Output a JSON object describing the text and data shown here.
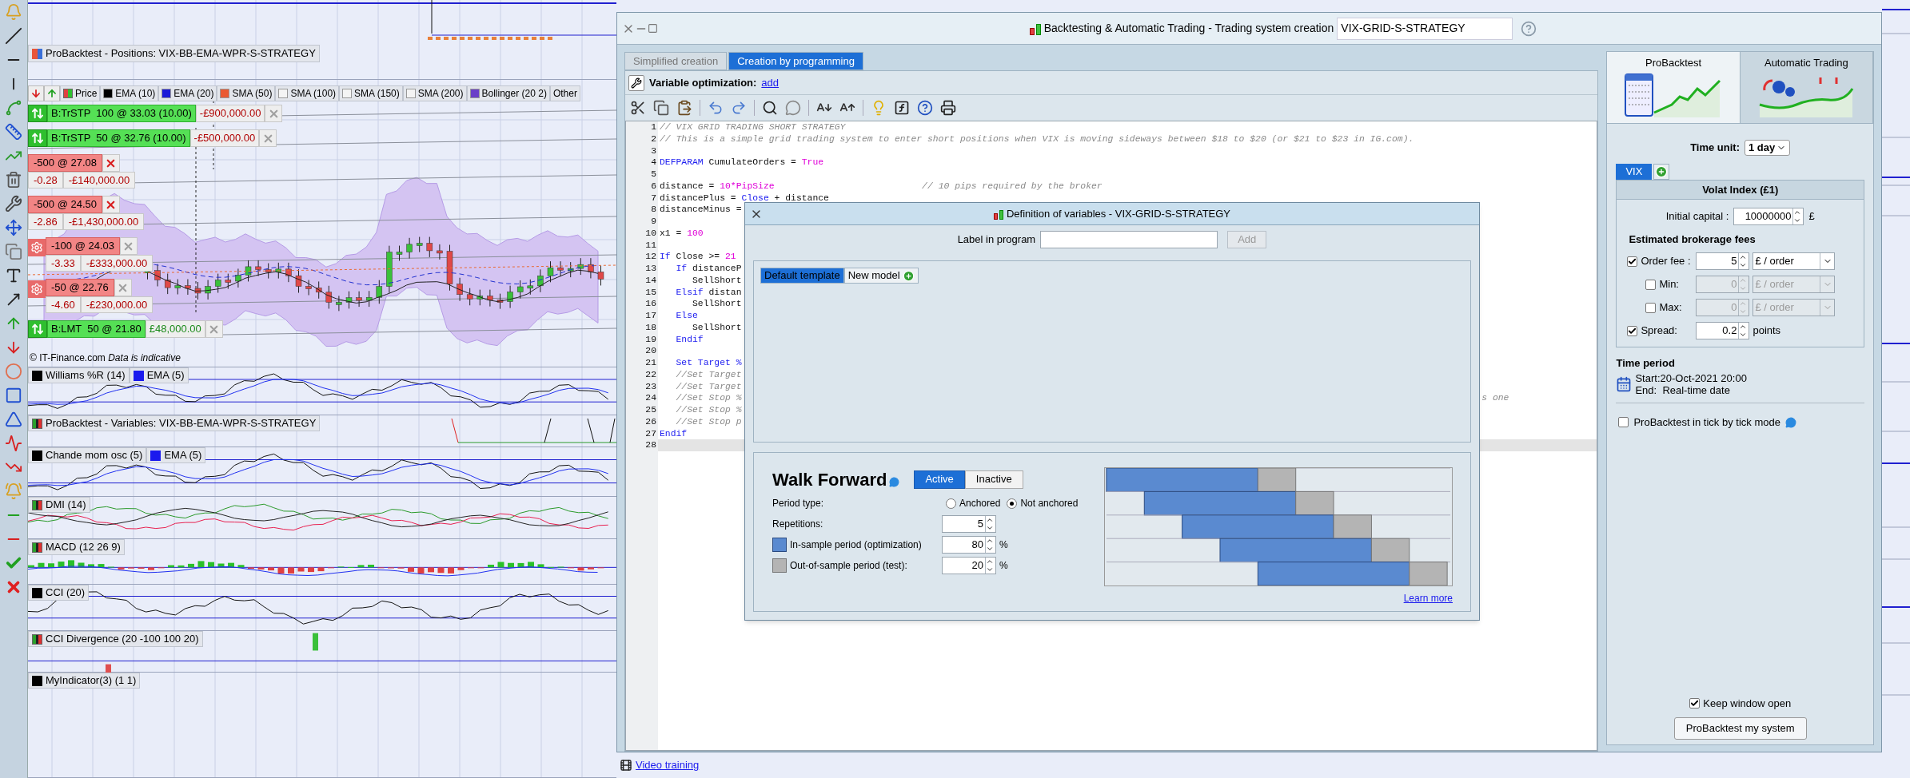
{
  "chart": {
    "positions_label": {
      "text": "ProBacktest - Positions: VIX-BB-EMA-WPR-S-STRATEGY"
    },
    "legend": [
      {
        "text": "Price",
        "kind": "price"
      },
      {
        "text": "EMA (10)",
        "kind": "line",
        "color": "#000000"
      },
      {
        "text": "EMA (20)",
        "kind": "line",
        "color": "#1a1ad8"
      },
      {
        "text": "SMA (50)",
        "kind": "line",
        "color": "#ea5a32"
      },
      {
        "text": "SMA (100)",
        "kind": "line",
        "color": "#f4f4f4"
      },
      {
        "text": "SMA (150)",
        "kind": "line",
        "color": "#f4f4f4"
      },
      {
        "text": "SMA (200)",
        "kind": "line",
        "color": "#f4f4f4"
      },
      {
        "text": "Bollinger (20 2)",
        "kind": "line",
        "color": "#6a3fc8"
      },
      {
        "text": "Other",
        "kind": "text"
      }
    ],
    "orders": [
      {
        "kind": "buy",
        "text": "B:TrSTP  100 @ 33.03 (10.00)",
        "value": "-£900,000.00",
        "profit": false
      },
      {
        "kind": "buy",
        "text": "B:TrSTP  50 @ 32.76 (10.00)",
        "value": "-£500,000.00",
        "profit": false
      },
      {
        "kind": "position",
        "text": "-500 @ 27.08",
        "points": "-0.28",
        "value": "-£140,000.00",
        "profit": false
      },
      {
        "kind": "position",
        "text": "-500 @ 24.50",
        "points": "-2.86",
        "value": "-£1,430,000.00",
        "profit": false
      },
      {
        "kind": "pending",
        "text": "-100 @ 24.03",
        "points": "-3.33",
        "value": "-£333,000.00",
        "profit": false
      },
      {
        "kind": "pending",
        "text": "-50 @ 22.76",
        "points": "-4.60",
        "value": "-£230,000.00",
        "profit": false
      },
      {
        "kind": "buy",
        "text": "B:LMT  50 @ 21.80",
        "value": "£48,000.00",
        "profit": true
      }
    ],
    "copyright": "© IT-Finance.com  *Data is indicative*",
    "panes": [
      {
        "kind": "oscillator",
        "legend": [
          {
            "text": "Williams %R (14)",
            "color": "#000000"
          },
          {
            "text": "EMA (5)",
            "color": "#1a1aee"
          }
        ]
      },
      {
        "kind": "signal",
        "legend": [
          {
            "text": "ProBacktest - Variables: VIX-BB-EMA-WPR-S-STRATEGY"
          }
        ]
      },
      {
        "kind": "oscillator",
        "legend": [
          {
            "text": "Chande mom osc (5)",
            "color": "#000000"
          },
          {
            "text": "EMA (5)",
            "color": "#1a1aee"
          }
        ]
      },
      {
        "kind": "dmi",
        "legend": [
          {
            "text": "DMI (14)"
          }
        ]
      },
      {
        "kind": "macd",
        "legend": [
          {
            "text": "MACD (12 26 9)"
          }
        ]
      },
      {
        "kind": "cci",
        "legend": [
          {
            "text": "CCI (20)",
            "color": "#000000"
          }
        ]
      },
      {
        "kind": "divergence",
        "legend": [
          {
            "text": "CCI Divergence (20 -100 100 20)"
          }
        ]
      },
      {
        "kind": "blank",
        "legend": [
          {
            "text": "MyIndicator(3) (1 1)",
            "color": "#000000"
          }
        ]
      }
    ]
  },
  "window": {
    "title": "Backtesting & Automatic Trading - Trading system creation",
    "system_name": "VIX-GRID-S-STRATEGY",
    "tabs": [
      {
        "label": "Simplified creation",
        "selected": false
      },
      {
        "label": "Creation by programming",
        "selected": true
      }
    ],
    "optimization": {
      "label": "Variable optimization:",
      "link": "add"
    },
    "code": [
      {
        "num": "1",
        "current": false,
        "segments": [
          {
            "t": "// VIX GRID TRADING SHORT STRATEGY",
            "kind": "comment"
          }
        ]
      },
      {
        "num": "2",
        "current": false,
        "segments": [
          {
            "t": "// This is a simple grid trading system to enter short positions when VIX is moving sideways between $18 to $20 (or $21 to $23 in IG.com).",
            "kind": "comment"
          }
        ]
      },
      {
        "num": "3",
        "current": false
      },
      {
        "num": "4",
        "current": false,
        "segments": [
          {
            "t": "DEFPARAM",
            "kind": "keyword"
          },
          {
            "t": " CumulateOrders = ",
            "kind": "plain"
          },
          {
            "t": "True",
            "kind": "number"
          }
        ]
      },
      {
        "num": "5",
        "current": false
      },
      {
        "num": "6",
        "current": false,
        "segments": [
          {
            "t": "distance = ",
            "kind": "plain"
          },
          {
            "t": "10*PipSize",
            "kind": "number"
          },
          {
            "t": "                           // 10 pips required by the broker",
            "kind": "comment"
          }
        ]
      },
      {
        "num": "7",
        "current": false,
        "segments": [
          {
            "t": "distancePlus = ",
            "kind": "plain"
          },
          {
            "t": "Close",
            "kind": "keyword"
          },
          {
            "t": " + distance",
            "kind": "plain"
          }
        ]
      },
      {
        "num": "8",
        "current": false,
        "segments": [
          {
            "t": "distanceMinus =",
            "kind": "plain"
          }
        ]
      },
      {
        "num": "9",
        "current": false
      },
      {
        "num": "10",
        "current": false,
        "segments": [
          {
            "t": "x1 = ",
            "kind": "plain"
          },
          {
            "t": "100",
            "kind": "number"
          }
        ]
      },
      {
        "num": "11",
        "current": false
      },
      {
        "num": "12",
        "current": false,
        "segments": [
          {
            "t": "If",
            "kind": "keyword"
          },
          {
            "t": " Close >= ",
            "kind": "plain"
          },
          {
            "t": "21",
            "kind": "number"
          }
        ]
      },
      {
        "num": "13",
        "current": false,
        "segments": [
          {
            "t": "   If",
            "kind": "keyword"
          },
          {
            "t": " distanceP",
            "kind": "plain"
          }
        ]
      },
      {
        "num": "14",
        "current": false,
        "segments": [
          {
            "t": "      SellShort",
            "kind": "plain"
          }
        ]
      },
      {
        "num": "15",
        "current": false,
        "segments": [
          {
            "t": "   Elsif",
            "kind": "keyword"
          },
          {
            "t": " distan",
            "kind": "plain"
          }
        ]
      },
      {
        "num": "16",
        "current": false,
        "segments": [
          {
            "t": "      SellShort",
            "kind": "plain"
          }
        ]
      },
      {
        "num": "17",
        "current": false,
        "segments": [
          {
            "t": "   Else",
            "kind": "keyword"
          }
        ]
      },
      {
        "num": "18",
        "current": false,
        "segments": [
          {
            "t": "      SellShort",
            "kind": "plain"
          }
        ]
      },
      {
        "num": "19",
        "current": false,
        "segments": [
          {
            "t": "   Endif",
            "kind": "keyword"
          }
        ]
      },
      {
        "num": "20",
        "current": false
      },
      {
        "num": "21",
        "current": false,
        "segments": [
          {
            "t": "   Set Target %",
            "kind": "keyword"
          }
        ]
      },
      {
        "num": "22",
        "current": false,
        "segments": [
          {
            "t": "   //Set Target",
            "kind": "comment"
          }
        ]
      },
      {
        "num": "23",
        "current": false,
        "segments": [
          {
            "t": "   //Set Target",
            "kind": "comment"
          }
        ]
      },
      {
        "num": "24",
        "current": false,
        "segments": [
          {
            "t": "   //Set Stop %",
            "kind": "comment"
          }
        ],
        "tail": "s one"
      },
      {
        "num": "25",
        "current": false,
        "segments": [
          {
            "t": "   //Set Stop %",
            "kind": "comment"
          }
        ]
      },
      {
        "num": "26",
        "current": false,
        "segments": [
          {
            "t": "   //Set Stop p",
            "kind": "comment"
          }
        ]
      },
      {
        "num": "27",
        "current": false,
        "segments": [
          {
            "t": "Endif",
            "kind": "keyword"
          }
        ]
      },
      {
        "num": "28",
        "current": true
      }
    ],
    "video_link": "Video training"
  },
  "backtest_panel": {
    "tabs": [
      {
        "label": "ProBacktest",
        "selected": true
      },
      {
        "label": "Automatic Trading",
        "selected": false
      }
    ],
    "time_unit": {
      "label": "Time unit:",
      "value": "1 day"
    },
    "instrument_tabs": [
      {
        "label": "VIX",
        "selected": true
      }
    ],
    "instrument_title": "Volat Index (£1)",
    "initial_capital": {
      "label": "Initial capital :",
      "value": "10000000",
      "unit": "£"
    },
    "fees_heading": "Estimated brokerage fees",
    "fees": [
      {
        "kind": "select",
        "label": "Order fee :",
        "checked": true,
        "disabled": false,
        "value": "5",
        "unit": "£ / order"
      },
      {
        "kind": "select",
        "label": "Min:",
        "checked": false,
        "disabled": true,
        "value": "0",
        "unit": "£ / order"
      },
      {
        "kind": "select",
        "label": "Max:",
        "checked": false,
        "disabled": true,
        "value": "0",
        "unit": "£ / order"
      },
      {
        "kind": "text",
        "label": "Spread:",
        "checked": true,
        "disabled": false,
        "value": "0.2",
        "unit": "points"
      }
    ],
    "time_period": {
      "heading": "Time period",
      "start": "Start:20-Oct-2021 20:00",
      "end": "End:  Real-time date"
    },
    "tick_mode": {
      "label": "ProBacktest in tick by tick mode",
      "checked": false
    },
    "keep_open": {
      "label": "Keep window open",
      "checked": true
    },
    "run_button": "ProBacktest my system"
  },
  "variables_dialog": {
    "title": "Definition of variables - VIX-GRID-S-STRATEGY",
    "label_field": {
      "label": "Label in program",
      "button": "Add",
      "disabled": true
    },
    "templates": [
      {
        "label": "Default template",
        "selected": true
      },
      {
        "label": "New model",
        "selected": false
      }
    ],
    "walk_forward": {
      "title": "Walk Forward",
      "modes": [
        {
          "label": "Active",
          "selected": true
        },
        {
          "label": "Inactive",
          "selected": false
        }
      ],
      "period_label": "Period type:",
      "period_types": [
        {
          "label": "Anchored",
          "selected": false
        },
        {
          "label": "Not anchored",
          "selected": true
        }
      ],
      "fields": [
        {
          "kind": "plain",
          "label": "Repetitions:",
          "value": "5"
        },
        {
          "kind": "in_sample",
          "label": "In-sample period (optimization)",
          "value": "80",
          "unit": "%"
        },
        {
          "kind": "out_sample",
          "label": "Out-of-sample period (test):",
          "value": "20",
          "unit": "%"
        }
      ],
      "link": "Learn more"
    }
  }
}
